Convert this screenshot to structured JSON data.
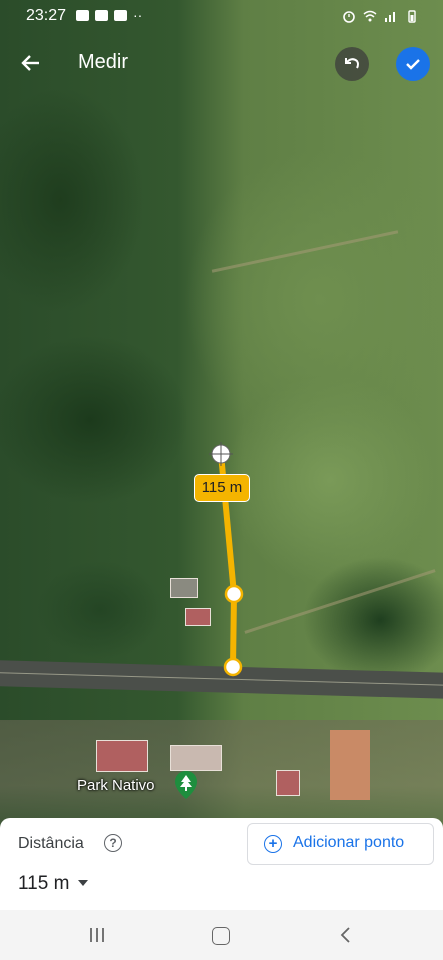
{
  "status_bar": {
    "time": "23:27",
    "left_icons": [
      "gallery-icon",
      "youtube-icon",
      "youtube-icon"
    ],
    "dots": "··",
    "right_icons": [
      "alarm-icon",
      "wifi-icon",
      "signal-icon",
      "battery-icon"
    ]
  },
  "toolbar": {
    "title": "Medir",
    "back_icon": "arrow-left-icon",
    "undo_icon": "undo-icon",
    "confirm_icon": "check-icon"
  },
  "map": {
    "segment_label": "115 m",
    "place_label": "Park Nativo",
    "place_icon": "tree-pin-icon"
  },
  "bottom_sheet": {
    "distance_title": "Distância",
    "help_icon": "help-circle-icon",
    "add_point_label": "Adicionar ponto",
    "distance_value": "115 m"
  },
  "nav_bar": {
    "icons": [
      "recents-icon",
      "home-icon",
      "back-icon"
    ]
  },
  "colors": {
    "accent": "#1a73e8",
    "measure_line": "#f4b400"
  }
}
